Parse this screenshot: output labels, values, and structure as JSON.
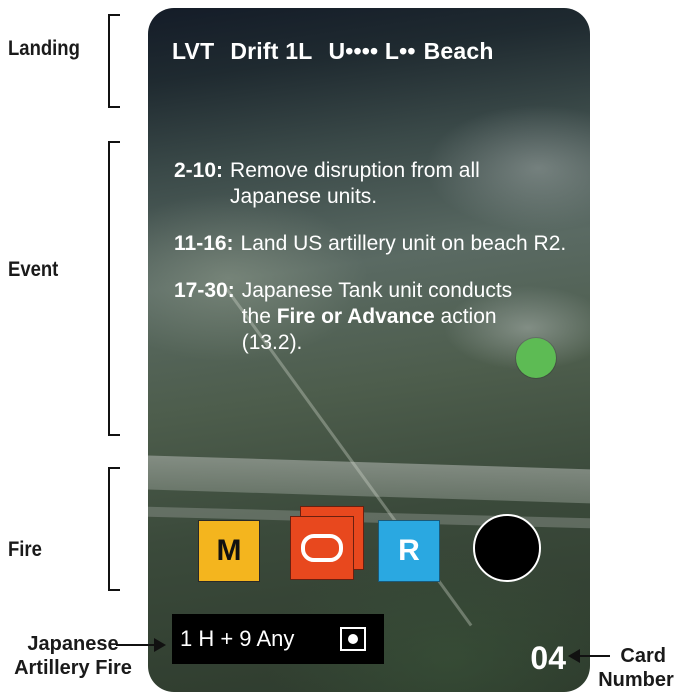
{
  "side_labels": {
    "landing": "Landing",
    "event": "Event",
    "fire": "Fire"
  },
  "card": {
    "header": {
      "landing_type": "LVT",
      "drift": "Drift 1L",
      "marks": "U•••• L••",
      "beach": "Beach"
    },
    "events": [
      {
        "range": "2-10:",
        "text": "Remove disruption from all Japanese units."
      },
      {
        "range": "11-16:",
        "text": "Land US artillery unit on beach R2."
      },
      {
        "range": "17-30:",
        "text_before": "Japanese Tank unit conducts the ",
        "text_bold": "Fire or Advance",
        "text_after": " action (13.2)."
      }
    ],
    "fire_chips": [
      {
        "label": "M",
        "color": "#f4b51e"
      },
      {
        "label": "",
        "color": "#e8481e"
      },
      {
        "label": "R",
        "color": "#2aa8e1"
      }
    ],
    "japanese_artillery_fire": "1 H + 9 Any",
    "card_number": "04"
  },
  "callouts": {
    "japanese_artillery_fire_line1": "Japanese",
    "japanese_artillery_fire_line2": "Artillery Fire",
    "card_number_line1": "Card",
    "card_number_line2": "Number"
  },
  "colors": {
    "green_marker": "#5dbb54",
    "black_marker": "#000000"
  }
}
